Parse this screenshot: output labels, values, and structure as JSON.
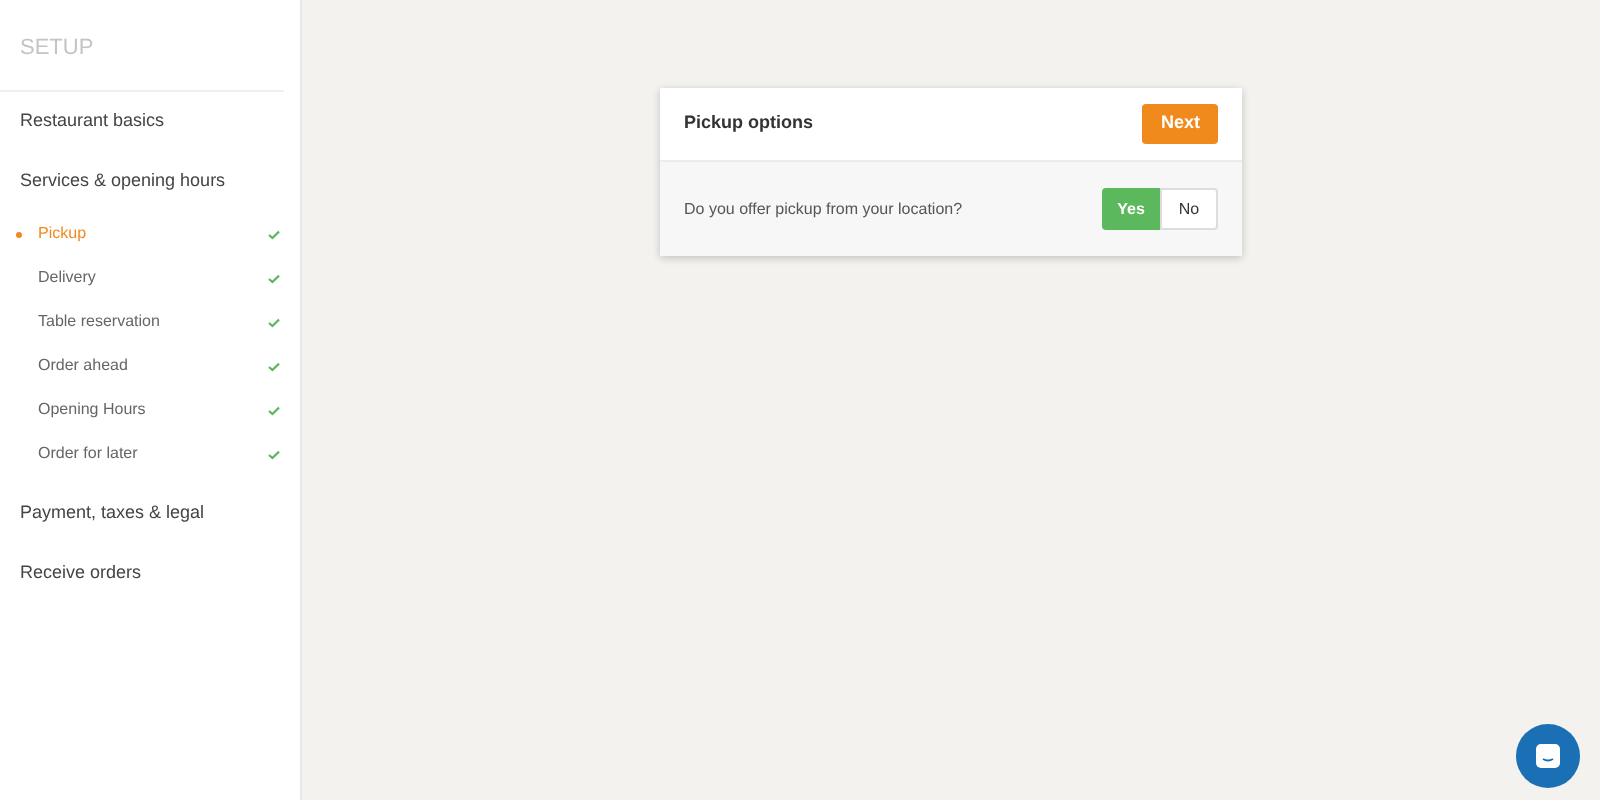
{
  "sidebar": {
    "heading": "SETUP",
    "sections": [
      {
        "label": "Restaurant basics"
      },
      {
        "label": "Services & opening hours",
        "children": [
          {
            "label": "Pickup",
            "selected": true,
            "done": true
          },
          {
            "label": "Delivery",
            "selected": false,
            "done": true
          },
          {
            "label": "Table reservation",
            "selected": false,
            "done": true
          },
          {
            "label": "Order ahead",
            "selected": false,
            "done": true
          },
          {
            "label": "Opening Hours",
            "selected": false,
            "done": true
          },
          {
            "label": "Order for later",
            "selected": false,
            "done": true
          }
        ]
      },
      {
        "label": "Payment, taxes & legal"
      },
      {
        "label": "Receive orders"
      }
    ]
  },
  "card": {
    "title": "Pickup options",
    "next_button": "Next",
    "question": "Do you offer pickup from your location?",
    "options": [
      {
        "label": "Yes",
        "selected": true
      },
      {
        "label": "No",
        "selected": false
      }
    ]
  }
}
